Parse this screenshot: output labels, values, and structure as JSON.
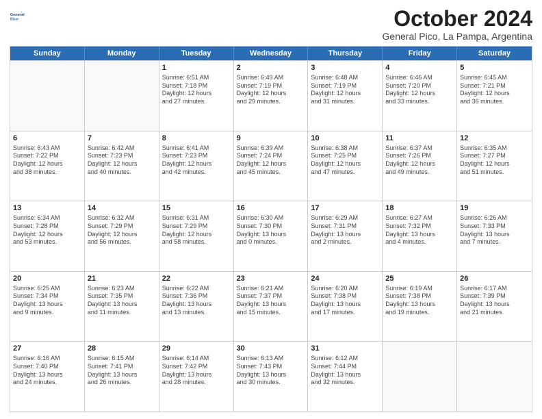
{
  "logo": {
    "line1": "General",
    "line2": "Blue"
  },
  "title": "October 2024",
  "subtitle": "General Pico, La Pampa, Argentina",
  "days": [
    "Sunday",
    "Monday",
    "Tuesday",
    "Wednesday",
    "Thursday",
    "Friday",
    "Saturday"
  ],
  "weeks": [
    [
      {
        "day": "",
        "info": ""
      },
      {
        "day": "",
        "info": ""
      },
      {
        "day": "1",
        "info": "Sunrise: 6:51 AM\nSunset: 7:18 PM\nDaylight: 12 hours\nand 27 minutes."
      },
      {
        "day": "2",
        "info": "Sunrise: 6:49 AM\nSunset: 7:19 PM\nDaylight: 12 hours\nand 29 minutes."
      },
      {
        "day": "3",
        "info": "Sunrise: 6:48 AM\nSunset: 7:19 PM\nDaylight: 12 hours\nand 31 minutes."
      },
      {
        "day": "4",
        "info": "Sunrise: 6:46 AM\nSunset: 7:20 PM\nDaylight: 12 hours\nand 33 minutes."
      },
      {
        "day": "5",
        "info": "Sunrise: 6:45 AM\nSunset: 7:21 PM\nDaylight: 12 hours\nand 36 minutes."
      }
    ],
    [
      {
        "day": "6",
        "info": "Sunrise: 6:43 AM\nSunset: 7:22 PM\nDaylight: 12 hours\nand 38 minutes."
      },
      {
        "day": "7",
        "info": "Sunrise: 6:42 AM\nSunset: 7:23 PM\nDaylight: 12 hours\nand 40 minutes."
      },
      {
        "day": "8",
        "info": "Sunrise: 6:41 AM\nSunset: 7:23 PM\nDaylight: 12 hours\nand 42 minutes."
      },
      {
        "day": "9",
        "info": "Sunrise: 6:39 AM\nSunset: 7:24 PM\nDaylight: 12 hours\nand 45 minutes."
      },
      {
        "day": "10",
        "info": "Sunrise: 6:38 AM\nSunset: 7:25 PM\nDaylight: 12 hours\nand 47 minutes."
      },
      {
        "day": "11",
        "info": "Sunrise: 6:37 AM\nSunset: 7:26 PM\nDaylight: 12 hours\nand 49 minutes."
      },
      {
        "day": "12",
        "info": "Sunrise: 6:35 AM\nSunset: 7:27 PM\nDaylight: 12 hours\nand 51 minutes."
      }
    ],
    [
      {
        "day": "13",
        "info": "Sunrise: 6:34 AM\nSunset: 7:28 PM\nDaylight: 12 hours\nand 53 minutes."
      },
      {
        "day": "14",
        "info": "Sunrise: 6:32 AM\nSunset: 7:29 PM\nDaylight: 12 hours\nand 56 minutes."
      },
      {
        "day": "15",
        "info": "Sunrise: 6:31 AM\nSunset: 7:29 PM\nDaylight: 12 hours\nand 58 minutes."
      },
      {
        "day": "16",
        "info": "Sunrise: 6:30 AM\nSunset: 7:30 PM\nDaylight: 13 hours\nand 0 minutes."
      },
      {
        "day": "17",
        "info": "Sunrise: 6:29 AM\nSunset: 7:31 PM\nDaylight: 13 hours\nand 2 minutes."
      },
      {
        "day": "18",
        "info": "Sunrise: 6:27 AM\nSunset: 7:32 PM\nDaylight: 13 hours\nand 4 minutes."
      },
      {
        "day": "19",
        "info": "Sunrise: 6:26 AM\nSunset: 7:33 PM\nDaylight: 13 hours\nand 7 minutes."
      }
    ],
    [
      {
        "day": "20",
        "info": "Sunrise: 6:25 AM\nSunset: 7:34 PM\nDaylight: 13 hours\nand 9 minutes."
      },
      {
        "day": "21",
        "info": "Sunrise: 6:23 AM\nSunset: 7:35 PM\nDaylight: 13 hours\nand 11 minutes."
      },
      {
        "day": "22",
        "info": "Sunrise: 6:22 AM\nSunset: 7:36 PM\nDaylight: 13 hours\nand 13 minutes."
      },
      {
        "day": "23",
        "info": "Sunrise: 6:21 AM\nSunset: 7:37 PM\nDaylight: 13 hours\nand 15 minutes."
      },
      {
        "day": "24",
        "info": "Sunrise: 6:20 AM\nSunset: 7:38 PM\nDaylight: 13 hours\nand 17 minutes."
      },
      {
        "day": "25",
        "info": "Sunrise: 6:19 AM\nSunset: 7:38 PM\nDaylight: 13 hours\nand 19 minutes."
      },
      {
        "day": "26",
        "info": "Sunrise: 6:17 AM\nSunset: 7:39 PM\nDaylight: 13 hours\nand 21 minutes."
      }
    ],
    [
      {
        "day": "27",
        "info": "Sunrise: 6:16 AM\nSunset: 7:40 PM\nDaylight: 13 hours\nand 24 minutes."
      },
      {
        "day": "28",
        "info": "Sunrise: 6:15 AM\nSunset: 7:41 PM\nDaylight: 13 hours\nand 26 minutes."
      },
      {
        "day": "29",
        "info": "Sunrise: 6:14 AM\nSunset: 7:42 PM\nDaylight: 13 hours\nand 28 minutes."
      },
      {
        "day": "30",
        "info": "Sunrise: 6:13 AM\nSunset: 7:43 PM\nDaylight: 13 hours\nand 30 minutes."
      },
      {
        "day": "31",
        "info": "Sunrise: 6:12 AM\nSunset: 7:44 PM\nDaylight: 13 hours\nand 32 minutes."
      },
      {
        "day": "",
        "info": ""
      },
      {
        "day": "",
        "info": ""
      }
    ]
  ]
}
